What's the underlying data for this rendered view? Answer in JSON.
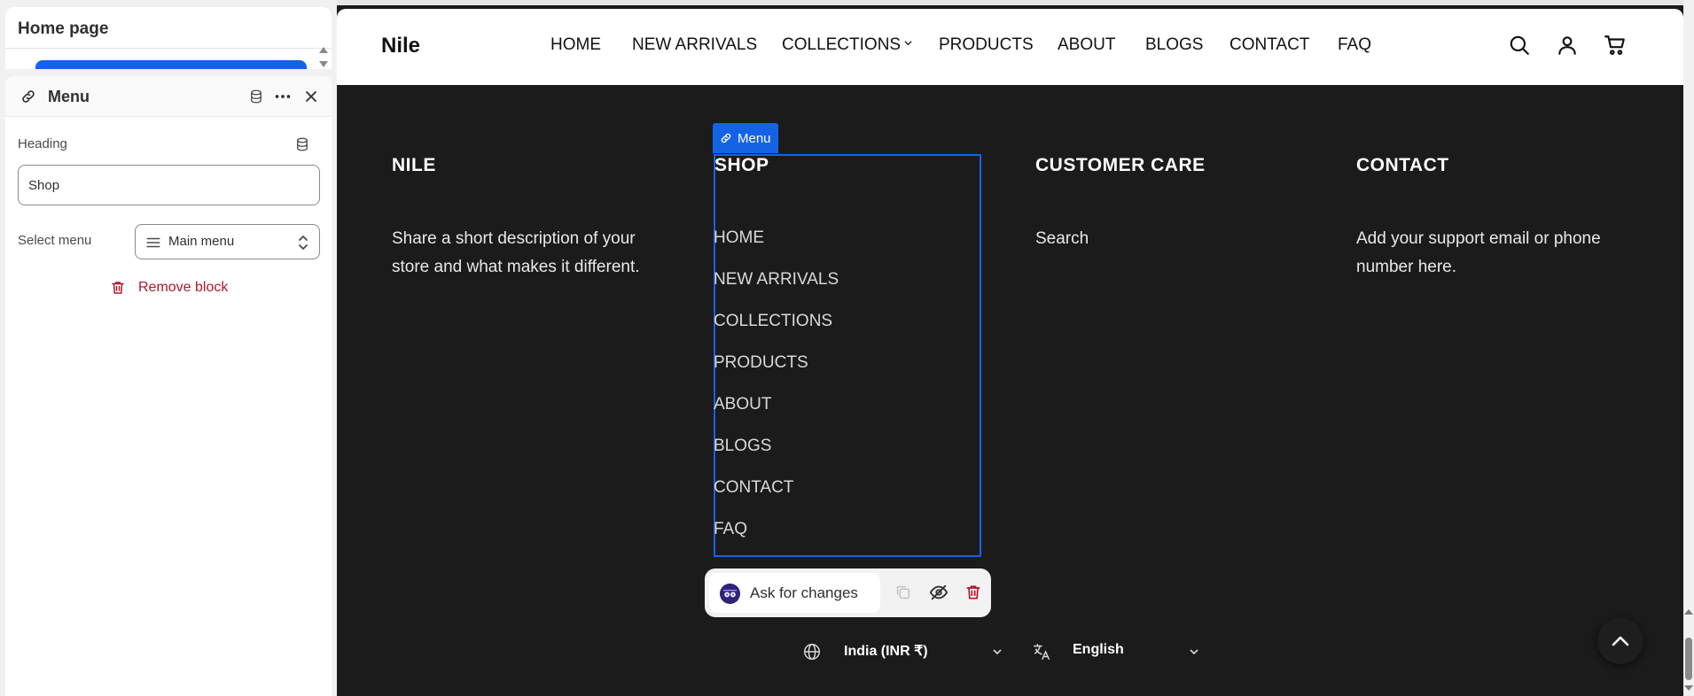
{
  "editor": {
    "top_card_title": "Home page",
    "panel_title": "Menu",
    "heading_label": "Heading",
    "heading_value": "Shop",
    "select_menu_label": "Select menu",
    "select_menu_value": "Main menu",
    "remove_block_label": "Remove block",
    "accent_color": "#1463e6",
    "danger_color": "#b0172b"
  },
  "store": {
    "logo": "Nile",
    "nav": [
      "HOME",
      "NEW ARRIVALS",
      "COLLECTIONS",
      "PRODUCTS",
      "ABOUT",
      "BLOGS",
      "CONTACT",
      "FAQ"
    ],
    "icons": [
      "search-icon",
      "account-icon",
      "cart-icon"
    ]
  },
  "footer": {
    "col1_heading": "NILE",
    "col1_desc_1": "Share a short description of your",
    "col1_desc_2": "store and what makes it different.",
    "col2_heading": "SHOP",
    "menu_items": [
      "HOME",
      "NEW ARRIVALS",
      "COLLECTIONS",
      "PRODUCTS",
      "ABOUT",
      "BLOGS",
      "CONTACT",
      "FAQ"
    ],
    "col3_heading": "CUSTOMER CARE",
    "col3_link": "Search",
    "col4_heading": "CONTACT",
    "col4_desc_1": "Add your support email or phone",
    "col4_desc_2": "number here.",
    "selection_tag": "Menu",
    "ask_label": "Ask for changes",
    "country": "India (INR ₹)",
    "language": "English",
    "background_color": "#1b1b1c"
  }
}
